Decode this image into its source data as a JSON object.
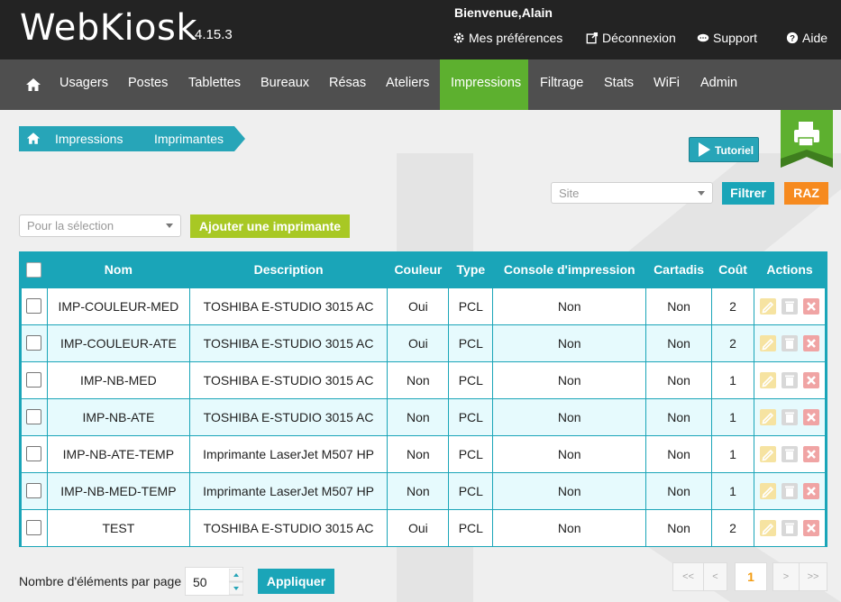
{
  "app": {
    "name": "WebKiosk",
    "version": "4.15.3",
    "welcome": "Bienvenue,Alain"
  },
  "header_links": [
    {
      "label": "Mes préférences",
      "icon": "gear-icon"
    },
    {
      "label": "Déconnexion",
      "icon": "external-link-icon"
    },
    {
      "label": "Support",
      "icon": "chat-icon"
    },
    {
      "label": "Aide",
      "icon": "question-icon"
    }
  ],
  "nav": {
    "items": [
      "Usagers",
      "Postes",
      "Tablettes",
      "Bureaux",
      "Résas",
      "Ateliers",
      "Impressions",
      "Filtrage",
      "Stats",
      "WiFi",
      "Admin"
    ],
    "active": "Impressions"
  },
  "breadcrumb": [
    "Impressions",
    "Imprimantes"
  ],
  "tutorial_label": "Tutoriel",
  "filters": {
    "site_placeholder": "Site",
    "filter_button": "Filtrer",
    "reset_button": "RAZ",
    "selection_placeholder": "Pour la sélection",
    "add_button": "Ajouter une imprimante"
  },
  "table": {
    "headers": [
      "Nom",
      "Description",
      "Couleur",
      "Type",
      "Console d'impression",
      "Cartadis",
      "Coût",
      "Actions"
    ],
    "rows": [
      [
        "IMP-COULEUR-MED",
        "TOSHIBA E-STUDIO 3015 AC",
        "Oui",
        "PCL",
        "Non",
        "Non",
        "2"
      ],
      [
        "IMP-COULEUR-ATE",
        "TOSHIBA E-STUDIO 3015 AC",
        "Oui",
        "PCL",
        "Non",
        "Non",
        "2"
      ],
      [
        "IMP-NB-MED",
        "TOSHIBA E-STUDIO 3015 AC",
        "Non",
        "PCL",
        "Non",
        "Non",
        "1"
      ],
      [
        "IMP-NB-ATE",
        "TOSHIBA E-STUDIO 3015 AC",
        "Non",
        "PCL",
        "Non",
        "Non",
        "1"
      ],
      [
        "IMP-NB-ATE-TEMP",
        "Imprimante LaserJet M507 HP",
        "Non",
        "PCL",
        "Non",
        "Non",
        "1"
      ],
      [
        "IMP-NB-MED-TEMP",
        "Imprimante LaserJet M507 HP",
        "Non",
        "PCL",
        "Non",
        "Non",
        "1"
      ],
      [
        "TEST",
        "TOSHIBA E-STUDIO 3015 AC",
        "Oui",
        "PCL",
        "Non",
        "Non",
        "2"
      ]
    ]
  },
  "footer": {
    "per_page_label": "Nombre d'éléments par page",
    "per_page_value": "50",
    "apply_button": "Appliquer",
    "pagination": {
      "first": "<<",
      "prev": "<",
      "current": "1",
      "next": ">",
      "last": ">>"
    }
  },
  "colors": {
    "accent": "#1aa5b8",
    "nav_active": "#5db02f",
    "add_button": "#a8c824",
    "reset": "#f68a1f"
  }
}
